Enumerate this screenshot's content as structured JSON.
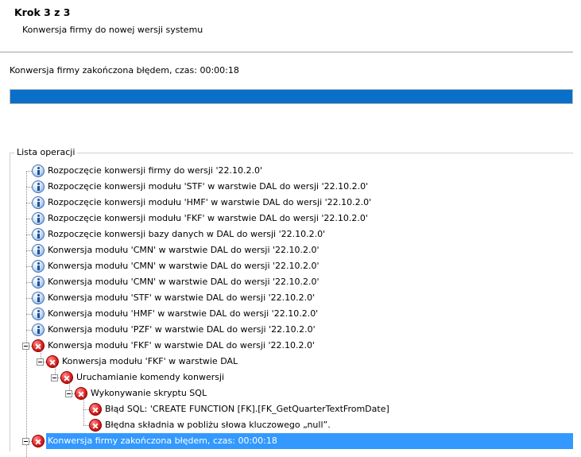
{
  "header": {
    "step_title": "Krok 3 z 3",
    "step_subtitle": "Konwersja firmy do nowej wersji systemu"
  },
  "status": {
    "text": "Konwersja firmy zakończona błędem, czas: 00:00:18",
    "progress_percent": 100,
    "progress_color": "#0a6fc9"
  },
  "operations": {
    "group_title": "Lista operacji",
    "items": [
      {
        "label": "Rozpoczęcie konwersji firmy do wersji '22.10.2.0'",
        "icon": "info-icon",
        "level": 0
      },
      {
        "label": "Rozpoczęcie konwersji modułu 'STF' w warstwie DAL do wersji '22.10.2.0'",
        "icon": "info-icon",
        "level": 0
      },
      {
        "label": "Rozpoczęcie konwersji modułu 'HMF' w warstwie DAL do wersji '22.10.2.0'",
        "icon": "info-icon",
        "level": 0
      },
      {
        "label": "Rozpoczęcie konwersji modułu 'FKF' w warstwie DAL do wersji '22.10.2.0'",
        "icon": "info-icon",
        "level": 0
      },
      {
        "label": "Rozpoczęcie konwersji bazy danych w DAL do wersji '22.10.2.0'",
        "icon": "info-icon",
        "level": 0
      },
      {
        "label": "Konwersja modułu 'CMN' w warstwie DAL do wersji '22.10.2.0'",
        "icon": "info-icon",
        "level": 0
      },
      {
        "label": "Konwersja modułu 'CMN' w warstwie DAL do wersji '22.10.2.0'",
        "icon": "info-icon",
        "level": 0
      },
      {
        "label": "Konwersja modułu 'CMN' w warstwie DAL do wersji '22.10.2.0'",
        "icon": "info-icon",
        "level": 0
      },
      {
        "label": "Konwersja modułu 'STF' w warstwie DAL do wersji '22.10.2.0'",
        "icon": "info-icon",
        "level": 0
      },
      {
        "label": "Konwersja modułu 'HMF' w warstwie DAL do wersji '22.10.2.0'",
        "icon": "info-icon",
        "level": 0
      },
      {
        "label": "Konwersja modułu 'PZF' w warstwie DAL do wersji '22.10.2.0'",
        "icon": "info-icon",
        "level": 0
      },
      {
        "label": "Konwersja modułu 'FKF' w warstwie DAL do wersji '22.10.2.0'",
        "icon": "error-icon",
        "level": 0,
        "expanded": true
      },
      {
        "label": "Konwersja modułu 'FKF' w warstwie DAL",
        "icon": "error-icon",
        "level": 1,
        "expanded": true
      },
      {
        "label": "Uruchamianie komendy konwersji",
        "icon": "error-icon",
        "level": 2,
        "expanded": true
      },
      {
        "label": "Wykonywanie skryptu SQL",
        "icon": "error-icon",
        "level": 3,
        "expanded": true
      },
      {
        "label": "Błąd SQL: 'CREATE FUNCTION [FK].[FK_GetQuarterTextFromDate]",
        "icon": "error-icon",
        "level": 4
      },
      {
        "label": "Błędna składnia w pobliżu słowa kluczowego „null”.",
        "icon": "error-icon",
        "level": 4
      },
      {
        "label": "Konwersja firmy zakończona błędem, czas: 00:00:18",
        "icon": "error-icon",
        "level": 0,
        "expanded": true,
        "selected": true
      }
    ]
  }
}
